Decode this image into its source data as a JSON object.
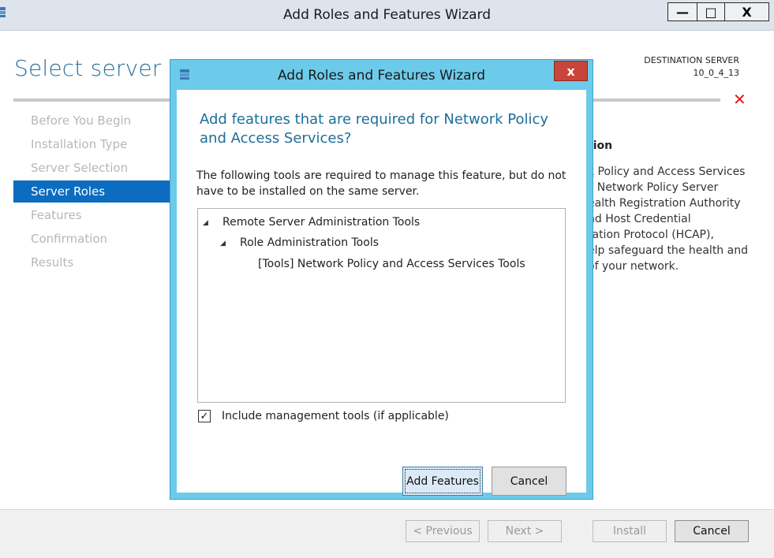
{
  "window": {
    "title": "Add Roles and Features Wizard",
    "minimize_glyph": "—",
    "maximize_glyph": "□",
    "close_glyph": "X"
  },
  "page": {
    "title": "Select server roles",
    "destination_label": "DESTINATION SERVER",
    "destination_value": "10_0_4_13",
    "error_icon": "red-x-icon"
  },
  "nav": {
    "items": [
      {
        "label": "Before You Begin"
      },
      {
        "label": "Installation Type"
      },
      {
        "label": "Server Selection"
      },
      {
        "label": "Server Roles"
      },
      {
        "label": "Features"
      },
      {
        "label": "Confirmation"
      },
      {
        "label": "Results"
      }
    ],
    "active_index": 3
  },
  "description": {
    "heading": "tion",
    "lines": [
      "k Policy and Access Services",
      "s Network Policy Server",
      "ealth Registration Authority",
      "nd Host Credential",
      "tation Protocol (HCAP),",
      "elp safeguard the health and",
      "of your network."
    ]
  },
  "footer": {
    "previous": "< Previous",
    "next": "Next >",
    "install": "Install",
    "cancel": "Cancel"
  },
  "dialog": {
    "title": "Add Roles and Features Wizard",
    "close_glyph": "x",
    "heading": "Add features that are required for Network Policy and Access Services?",
    "description": "The following tools are required to manage this feature, but do not have to be installed on the same server.",
    "tree": [
      {
        "label": "Remote Server Administration Tools",
        "expanded": true
      },
      {
        "label": "Role Administration Tools",
        "expanded": true
      },
      {
        "label": "[Tools] Network Policy and Access Services Tools"
      }
    ],
    "include_checked": true,
    "check_glyph": "✓",
    "include_label": "Include management tools (if applicable)",
    "add_button": "Add Features",
    "cancel_button": "Cancel"
  },
  "colors": {
    "accent": "#0c6cc0",
    "title_blue": "#2d6e9b",
    "dialog_frame": "#6ccbea",
    "close_red": "#c9443a",
    "error_red": "#e01a1a"
  }
}
